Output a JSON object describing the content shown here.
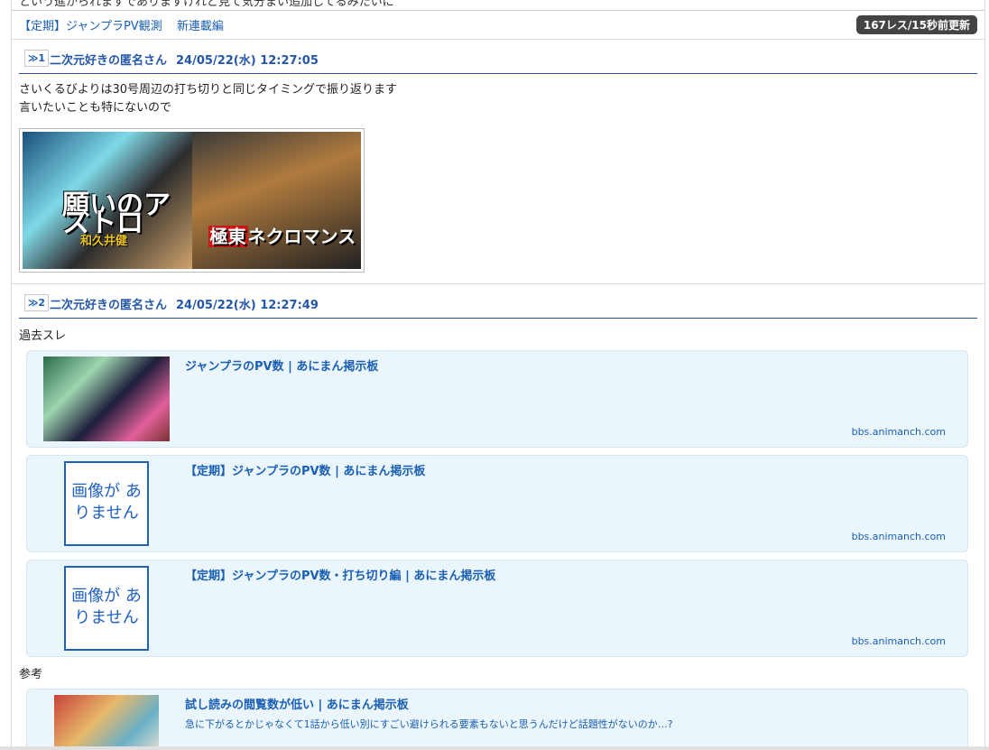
{
  "top_strip_text": "という進かられますでありますけれど見て気分まい追加してるみたいに",
  "nav": {
    "links": [
      "【定期】ジャンプラPV観測",
      "新連載編"
    ],
    "badge": "167レス/15秒前更新"
  },
  "posts": [
    {
      "num": "≫1",
      "author": "二次元好きの匿名さん",
      "date": "24/05/22(水) 12:27:05",
      "lines": [
        "さいくるびよりは30号周辺の打ち切りと同じタイミングで振り返ります",
        "言いたいことも特にないので"
      ],
      "image_text": {
        "left_title": "願いのアストロ",
        "left_author": "和久井健",
        "right_title_red": "極東",
        "right_title": "ネクロマンス"
      }
    },
    {
      "num": "≫2",
      "author": "二次元好きの匿名さん",
      "date": "24/05/22(水) 12:27:49",
      "label_past": "過去スレ",
      "label_ref": "参考",
      "cards": [
        {
          "title": "ジャンプラのPV数 | あにまん掲示板",
          "domain": "bbs.animanch.com",
          "desc": ""
        },
        {
          "title": "【定期】ジャンプラのPV数 | あにまん掲示板",
          "domain": "bbs.animanch.com",
          "noimage": "画像が ありません"
        },
        {
          "title": "【定期】ジャンプラのPV数・打ち切り編 | あにまん掲示板",
          "domain": "bbs.animanch.com",
          "noimage": "画像が ありません"
        }
      ],
      "ref_card": {
        "title": "試し読みの閲覧数が低い | あにまん掲示板",
        "desc": "急に下がるとかじゃなくて1話から低い別にすごい避けられる要素もないと思うんだけど話題性がないのか…?"
      }
    }
  ],
  "colors": {
    "link": "#1a5fb4",
    "header_line": "#2d4e9a",
    "card_bg": "#eaf6fc",
    "badge_bg": "#444444"
  },
  "icons": {
    "no_image": "placeholder-image-icon"
  }
}
